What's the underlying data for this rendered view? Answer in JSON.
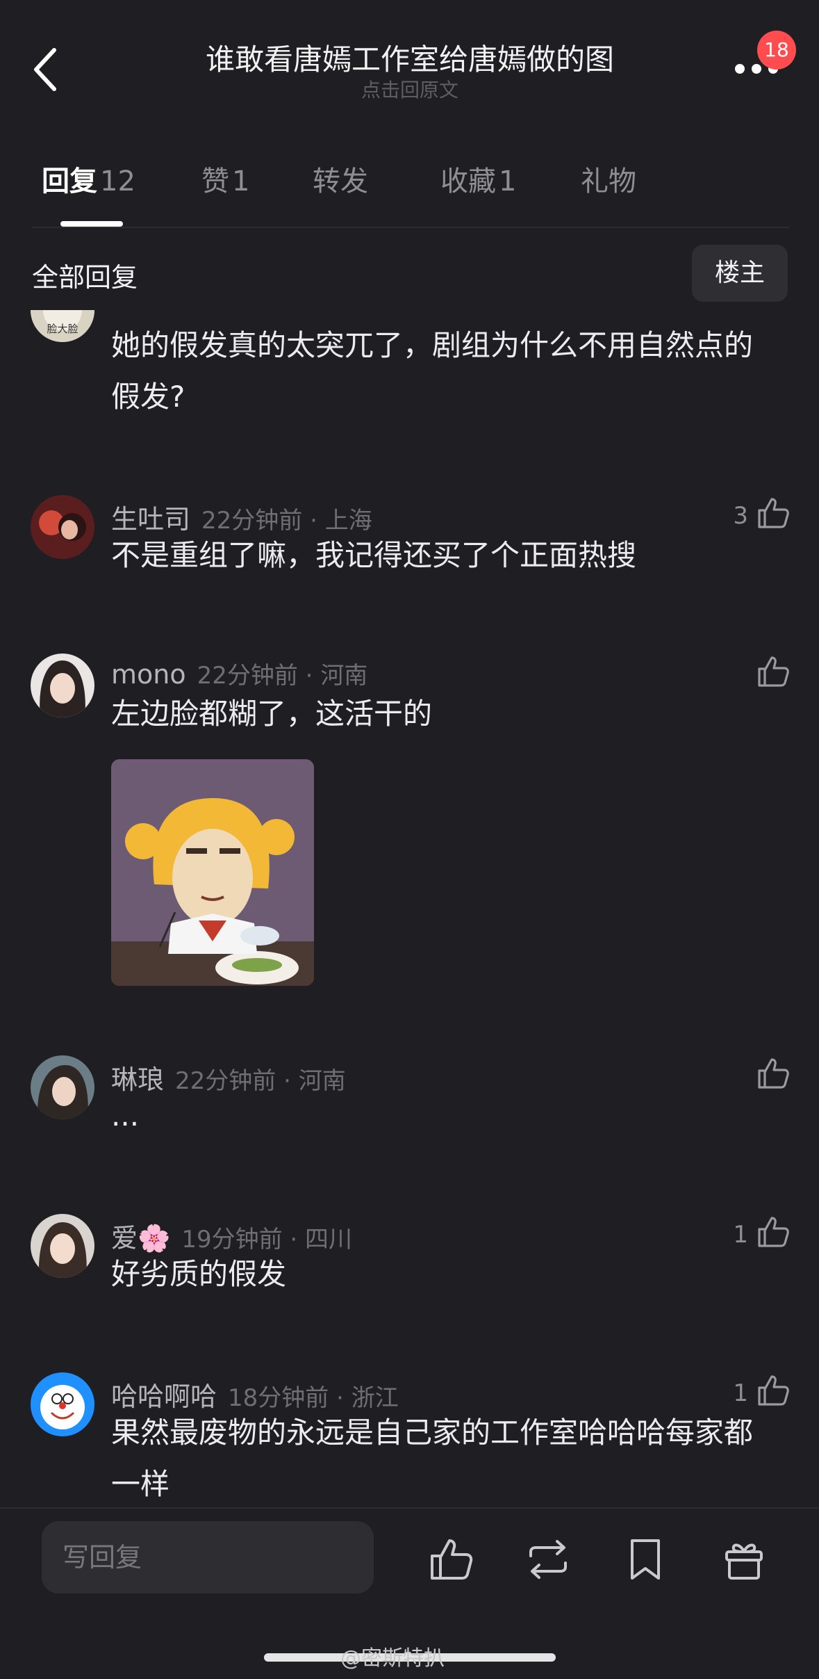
{
  "header": {
    "title": "谁敢看唐嫣工作室给唐嫣做的图",
    "subtitle": "点击回原文",
    "notification_count": "18"
  },
  "tabs": [
    {
      "label": "回复",
      "count": "12",
      "active": true
    },
    {
      "label": "赞",
      "count": "1"
    },
    {
      "label": "转发",
      "count": ""
    },
    {
      "label": "收藏",
      "count": "1"
    },
    {
      "label": "礼物",
      "count": ""
    }
  ],
  "filter": {
    "section_title": "全部回复",
    "op_button": "楼主"
  },
  "comments": [
    {
      "text": "她的假发真的太突兀了，剧组为什么不用自然点的假发?",
      "avatar_label": "脸大脸"
    },
    {
      "username": "生吐司",
      "time": "22分钟前",
      "location": "上海",
      "text": "不是重组了嘛，我记得还买了个正面热搜",
      "likes": "3"
    },
    {
      "username": "mono",
      "time": "22分钟前",
      "location": "河南",
      "text": "左边脸都糊了，这活干的",
      "likes": "",
      "has_sticker": true
    },
    {
      "username": "琳琅",
      "time": "22分钟前",
      "location": "河南",
      "text": "...",
      "likes": ""
    },
    {
      "username": "爱🌸",
      "time": "19分钟前",
      "location": "四川",
      "text": "好劣质的假发",
      "likes": "1"
    },
    {
      "username": "哈哈啊哈",
      "time": "18分钟前",
      "location": "浙江",
      "text": "果然最废物的永远是自己家的工作室哈哈哈每家都一样",
      "likes": "1"
    }
  ],
  "bottom_bar": {
    "reply_placeholder": "写回复"
  },
  "watermark": "@密斯特扒",
  "colors": {
    "background": "#1f1f23",
    "badge": "#ff4d4f",
    "text_secondary": "#8e8e93"
  }
}
